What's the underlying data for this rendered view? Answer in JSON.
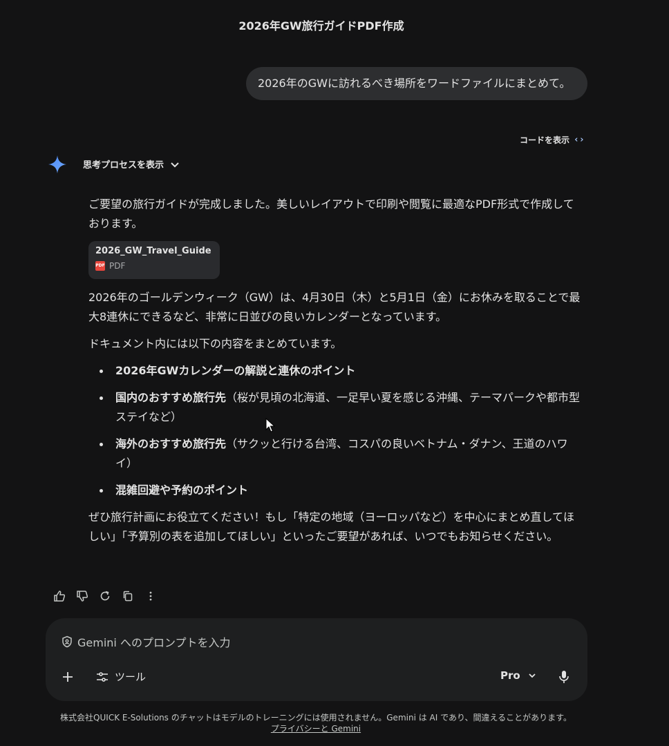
{
  "header": {
    "title": "2026年GW旅行ガイドPDF作成"
  },
  "user_message": "2026年のGWに訪れるべき場所をワードファイルにまとめて。",
  "show_code": {
    "label": "コードを表示",
    "icon": "code-icon"
  },
  "thinking": {
    "label": "思考プロセスを表示",
    "icon": "chevron-down-icon"
  },
  "response": {
    "intro": "ご要望の旅行ガイドが完成しました。美しいレイアウトで印刷や閲覧に最適なPDF形式で作成しております。",
    "file": {
      "name": "2026_GW_Travel_Guide",
      "type": "PDF",
      "icon_text": "PDF"
    },
    "paragraph1": "2026年のゴールデンウィーク（GW）は、4月30日（木）と5月1日（金）にお休みを取ることで最大8連休にできるなど、非常に日並びの良いカレンダーとなっています。",
    "paragraph2": "ドキュメント内には以下の内容をまとめています。",
    "bullets": [
      {
        "bold": "2026年GWカレンダーの解説と連休のポイント",
        "rest": ""
      },
      {
        "bold": "国内のおすすめ旅行先",
        "rest": "（桜が見頃の北海道、一足早い夏を感じる沖縄、テーマパークや都市型ステイなど）"
      },
      {
        "bold": "海外のおすすめ旅行先",
        "rest": "（サクッと行ける台湾、コスパの良いベトナム・ダナン、王道のハワイ）"
      },
      {
        "bold": "混雑回避や予約のポイント",
        "rest": ""
      }
    ],
    "closing": "ぜひ旅行計画にお役立てください！もし「特定の地域（ヨーロッパなど）を中心にまとめ直してほしい」「予算別の表を追加してほしい」といったご要望があれば、いつでもお知らせください。"
  },
  "prompt": {
    "placeholder": "Gemini へのプロンプトを入力",
    "tools_label": "ツール",
    "model_label": "Pro"
  },
  "footer": {
    "text": "株式会社QUICK E-Solutions のチャットはモデルのトレーニングには使用されません。Gemini は AI であり、間違えることがあります。",
    "link": "プライバシーと Gemini"
  },
  "colors": {
    "background": "#131314",
    "bubble": "#2d2e30",
    "input": "#1e1f20",
    "accent": "#a8c7fa",
    "pdf": "#e8453c"
  }
}
